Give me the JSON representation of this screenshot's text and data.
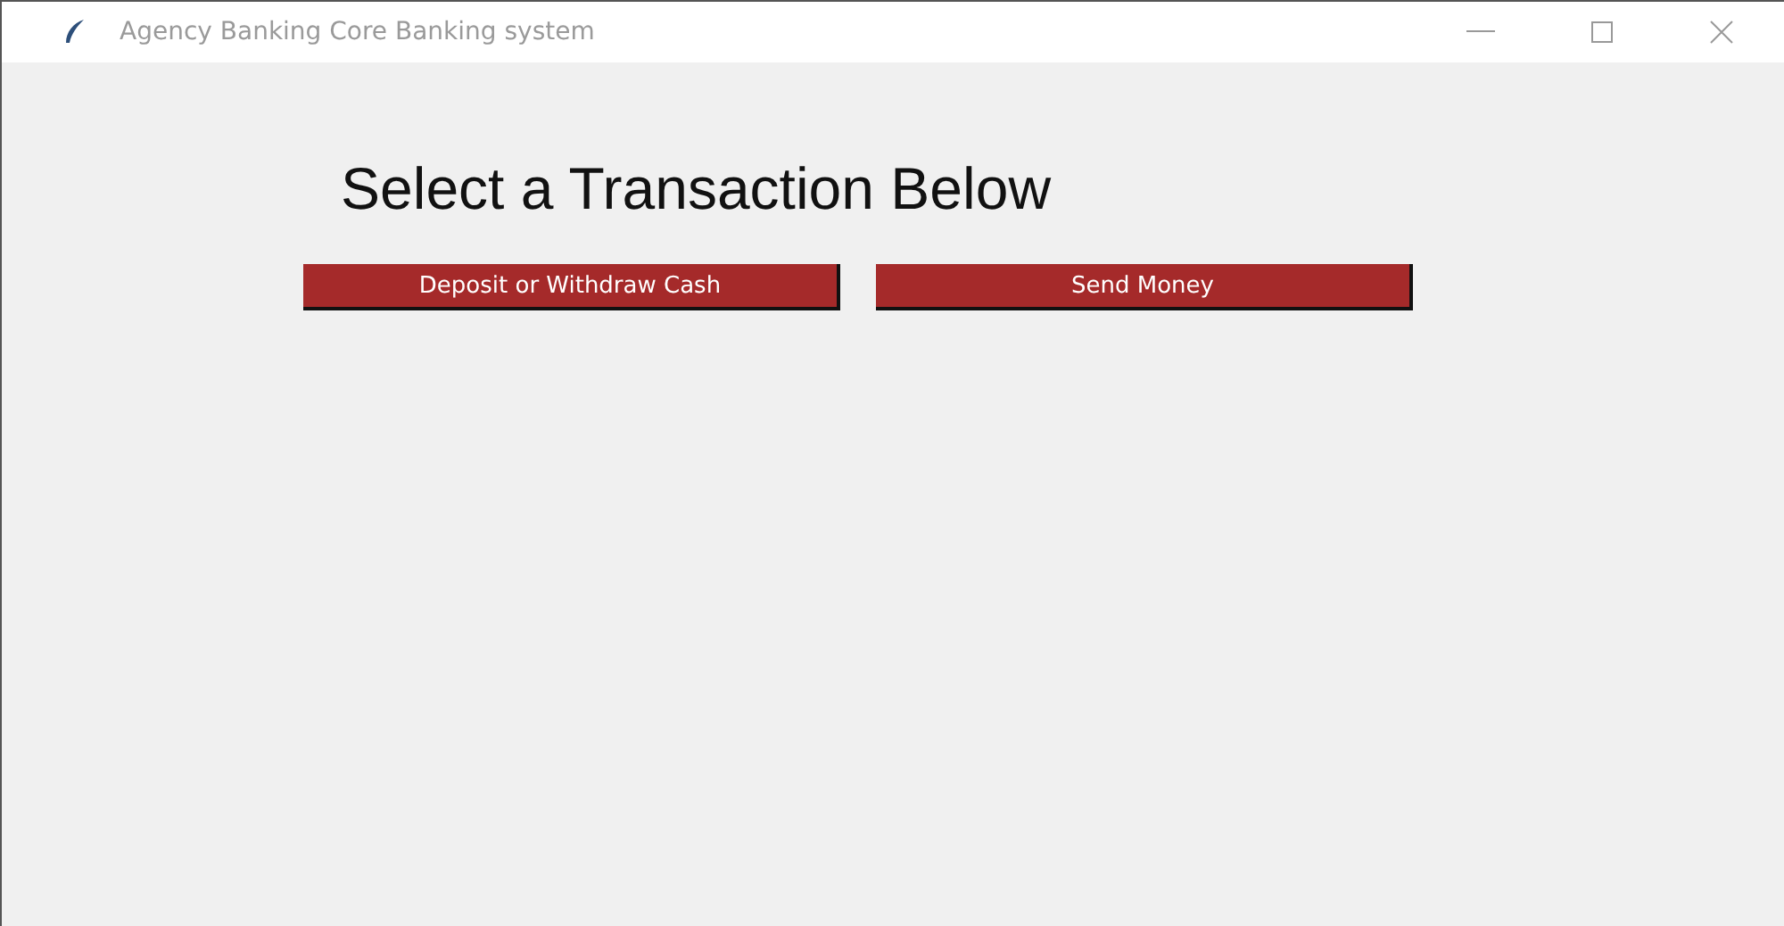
{
  "window": {
    "title": "Agency Banking Core Banking system"
  },
  "heading": "Select a Transaction Below",
  "buttons": [
    "Deposit or Withdraw Cash",
    "Send Money"
  ]
}
